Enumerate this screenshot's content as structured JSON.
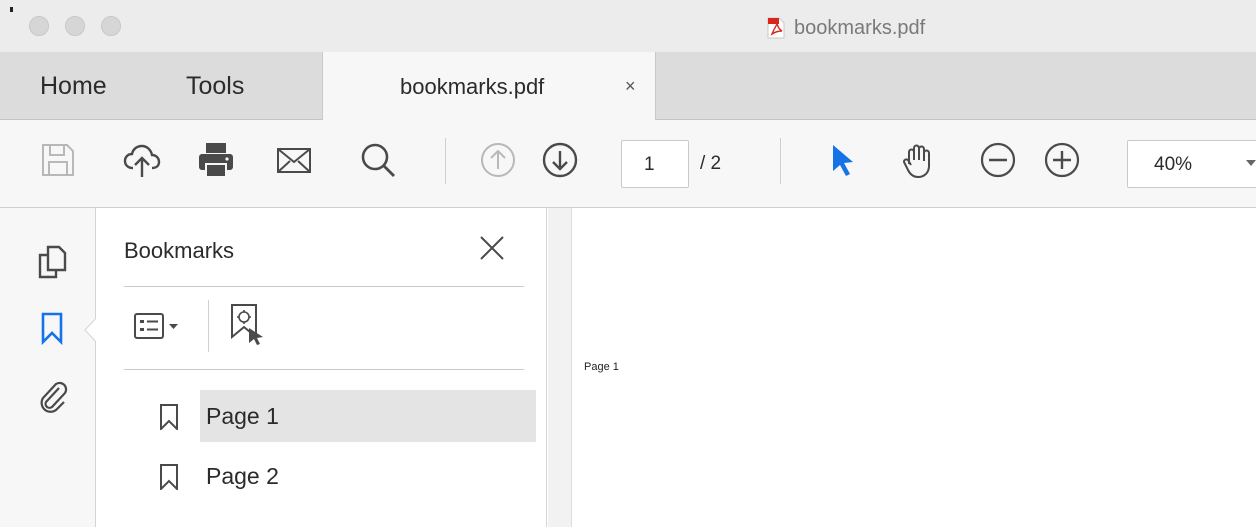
{
  "window": {
    "title": "bookmarks.pdf"
  },
  "tabs": {
    "home": "Home",
    "tools": "Tools",
    "document": "bookmarks.pdf",
    "close_symbol": "×"
  },
  "toolbar": {
    "icons": [
      "save-icon",
      "upload-cloud-icon",
      "print-icon",
      "email-icon",
      "search-icon",
      "previous-page-icon",
      "next-page-icon",
      "select-arrow-icon",
      "hand-icon",
      "zoom-out-icon",
      "zoom-in-icon"
    ],
    "current_page": "1",
    "total_pages": "/ 2",
    "zoom": "40%",
    "select_tool_color": "#1473e6"
  },
  "rail": {
    "icons": [
      "page-thumbnails-icon",
      "bookmarks-icon",
      "attachments-icon"
    ],
    "active": "bookmarks-icon"
  },
  "bookmarks_panel": {
    "title": "Bookmarks",
    "items": [
      {
        "label": "Page 1",
        "selected": true
      },
      {
        "label": "Page 2",
        "selected": false
      }
    ]
  },
  "document": {
    "page_text": "Page 1"
  }
}
